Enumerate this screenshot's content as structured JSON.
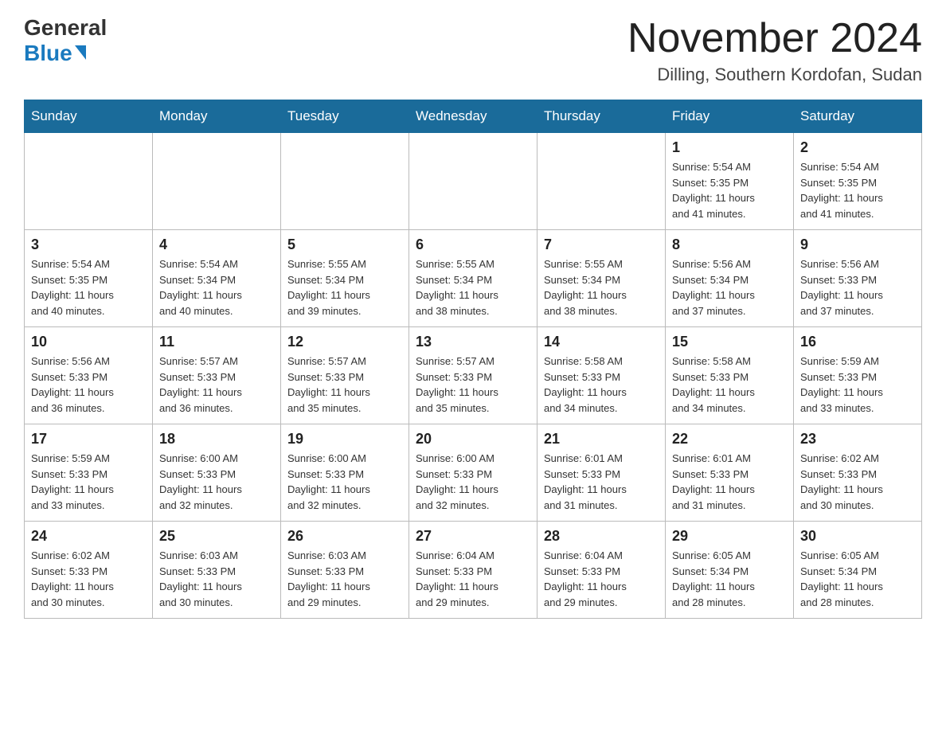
{
  "logo": {
    "general": "General",
    "blue": "Blue"
  },
  "header": {
    "month": "November 2024",
    "location": "Dilling, Southern Kordofan, Sudan"
  },
  "weekdays": [
    "Sunday",
    "Monday",
    "Tuesday",
    "Wednesday",
    "Thursday",
    "Friday",
    "Saturday"
  ],
  "weeks": [
    [
      {
        "day": "",
        "info": ""
      },
      {
        "day": "",
        "info": ""
      },
      {
        "day": "",
        "info": ""
      },
      {
        "day": "",
        "info": ""
      },
      {
        "day": "",
        "info": ""
      },
      {
        "day": "1",
        "info": "Sunrise: 5:54 AM\nSunset: 5:35 PM\nDaylight: 11 hours\nand 41 minutes."
      },
      {
        "day": "2",
        "info": "Sunrise: 5:54 AM\nSunset: 5:35 PM\nDaylight: 11 hours\nand 41 minutes."
      }
    ],
    [
      {
        "day": "3",
        "info": "Sunrise: 5:54 AM\nSunset: 5:35 PM\nDaylight: 11 hours\nand 40 minutes."
      },
      {
        "day": "4",
        "info": "Sunrise: 5:54 AM\nSunset: 5:34 PM\nDaylight: 11 hours\nand 40 minutes."
      },
      {
        "day": "5",
        "info": "Sunrise: 5:55 AM\nSunset: 5:34 PM\nDaylight: 11 hours\nand 39 minutes."
      },
      {
        "day": "6",
        "info": "Sunrise: 5:55 AM\nSunset: 5:34 PM\nDaylight: 11 hours\nand 38 minutes."
      },
      {
        "day": "7",
        "info": "Sunrise: 5:55 AM\nSunset: 5:34 PM\nDaylight: 11 hours\nand 38 minutes."
      },
      {
        "day": "8",
        "info": "Sunrise: 5:56 AM\nSunset: 5:34 PM\nDaylight: 11 hours\nand 37 minutes."
      },
      {
        "day": "9",
        "info": "Sunrise: 5:56 AM\nSunset: 5:33 PM\nDaylight: 11 hours\nand 37 minutes."
      }
    ],
    [
      {
        "day": "10",
        "info": "Sunrise: 5:56 AM\nSunset: 5:33 PM\nDaylight: 11 hours\nand 36 minutes."
      },
      {
        "day": "11",
        "info": "Sunrise: 5:57 AM\nSunset: 5:33 PM\nDaylight: 11 hours\nand 36 minutes."
      },
      {
        "day": "12",
        "info": "Sunrise: 5:57 AM\nSunset: 5:33 PM\nDaylight: 11 hours\nand 35 minutes."
      },
      {
        "day": "13",
        "info": "Sunrise: 5:57 AM\nSunset: 5:33 PM\nDaylight: 11 hours\nand 35 minutes."
      },
      {
        "day": "14",
        "info": "Sunrise: 5:58 AM\nSunset: 5:33 PM\nDaylight: 11 hours\nand 34 minutes."
      },
      {
        "day": "15",
        "info": "Sunrise: 5:58 AM\nSunset: 5:33 PM\nDaylight: 11 hours\nand 34 minutes."
      },
      {
        "day": "16",
        "info": "Sunrise: 5:59 AM\nSunset: 5:33 PM\nDaylight: 11 hours\nand 33 minutes."
      }
    ],
    [
      {
        "day": "17",
        "info": "Sunrise: 5:59 AM\nSunset: 5:33 PM\nDaylight: 11 hours\nand 33 minutes."
      },
      {
        "day": "18",
        "info": "Sunrise: 6:00 AM\nSunset: 5:33 PM\nDaylight: 11 hours\nand 32 minutes."
      },
      {
        "day": "19",
        "info": "Sunrise: 6:00 AM\nSunset: 5:33 PM\nDaylight: 11 hours\nand 32 minutes."
      },
      {
        "day": "20",
        "info": "Sunrise: 6:00 AM\nSunset: 5:33 PM\nDaylight: 11 hours\nand 32 minutes."
      },
      {
        "day": "21",
        "info": "Sunrise: 6:01 AM\nSunset: 5:33 PM\nDaylight: 11 hours\nand 31 minutes."
      },
      {
        "day": "22",
        "info": "Sunrise: 6:01 AM\nSunset: 5:33 PM\nDaylight: 11 hours\nand 31 minutes."
      },
      {
        "day": "23",
        "info": "Sunrise: 6:02 AM\nSunset: 5:33 PM\nDaylight: 11 hours\nand 30 minutes."
      }
    ],
    [
      {
        "day": "24",
        "info": "Sunrise: 6:02 AM\nSunset: 5:33 PM\nDaylight: 11 hours\nand 30 minutes."
      },
      {
        "day": "25",
        "info": "Sunrise: 6:03 AM\nSunset: 5:33 PM\nDaylight: 11 hours\nand 30 minutes."
      },
      {
        "day": "26",
        "info": "Sunrise: 6:03 AM\nSunset: 5:33 PM\nDaylight: 11 hours\nand 29 minutes."
      },
      {
        "day": "27",
        "info": "Sunrise: 6:04 AM\nSunset: 5:33 PM\nDaylight: 11 hours\nand 29 minutes."
      },
      {
        "day": "28",
        "info": "Sunrise: 6:04 AM\nSunset: 5:33 PM\nDaylight: 11 hours\nand 29 minutes."
      },
      {
        "day": "29",
        "info": "Sunrise: 6:05 AM\nSunset: 5:34 PM\nDaylight: 11 hours\nand 28 minutes."
      },
      {
        "day": "30",
        "info": "Sunrise: 6:05 AM\nSunset: 5:34 PM\nDaylight: 11 hours\nand 28 minutes."
      }
    ]
  ]
}
